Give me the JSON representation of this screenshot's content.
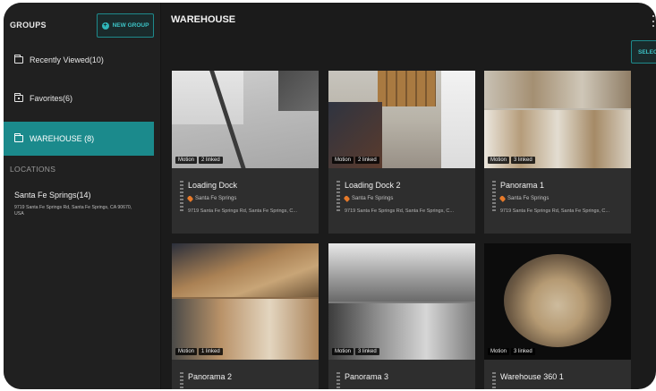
{
  "sidebar": {
    "groups_title": "GROUPS",
    "new_group_label": "NEW GROUP",
    "groups": [
      {
        "label": "Recently Viewed(10)",
        "icon": "folder-icon",
        "active": false
      },
      {
        "label": "Favorites(6)",
        "icon": "favorite-folder-icon",
        "active": false
      },
      {
        "label": "WAREHOUSE (8)",
        "icon": "folder-icon",
        "active": true
      }
    ],
    "locations_title": "LOCATIONS",
    "location": {
      "name": "Santa Fe Springs(14)",
      "address": "9719 Santa Fe Springs Rd, Santa Fe Springs, CA 90670, USA"
    }
  },
  "main": {
    "title": "WAREHOUSE",
    "select_label": "SELECT",
    "cameras": [
      {
        "name": "Loading Dock",
        "status": "Motion",
        "linked": "2 linked",
        "location": "Santa Fe Springs",
        "address": "9719 Santa Fe Springs Rd, Santa Fe Springs, C..."
      },
      {
        "name": "Loading Dock 2",
        "status": "Motion",
        "linked": "2 linked",
        "location": "Santa Fe Springs",
        "address": "9719 Santa Fe Springs Rd, Santa Fe Springs, C..."
      },
      {
        "name": "Panorama 1",
        "status": "Motion",
        "linked": "3 linked",
        "location": "Santa Fe Springs",
        "address": "9719 Santa Fe Springs Rd, Santa Fe Springs, C..."
      },
      {
        "name": "Panorama 2",
        "status": "Motion",
        "linked": "1 linked"
      },
      {
        "name": "Panorama 3",
        "status": "Motion",
        "linked": "3 linked"
      },
      {
        "name": "Warehouse 360 1",
        "status": "Motion",
        "linked": "3 linked"
      }
    ]
  },
  "colors": {
    "accent": "#1b8a8c",
    "background": "#1b1b1b",
    "location_pin": "#e67a2a"
  }
}
